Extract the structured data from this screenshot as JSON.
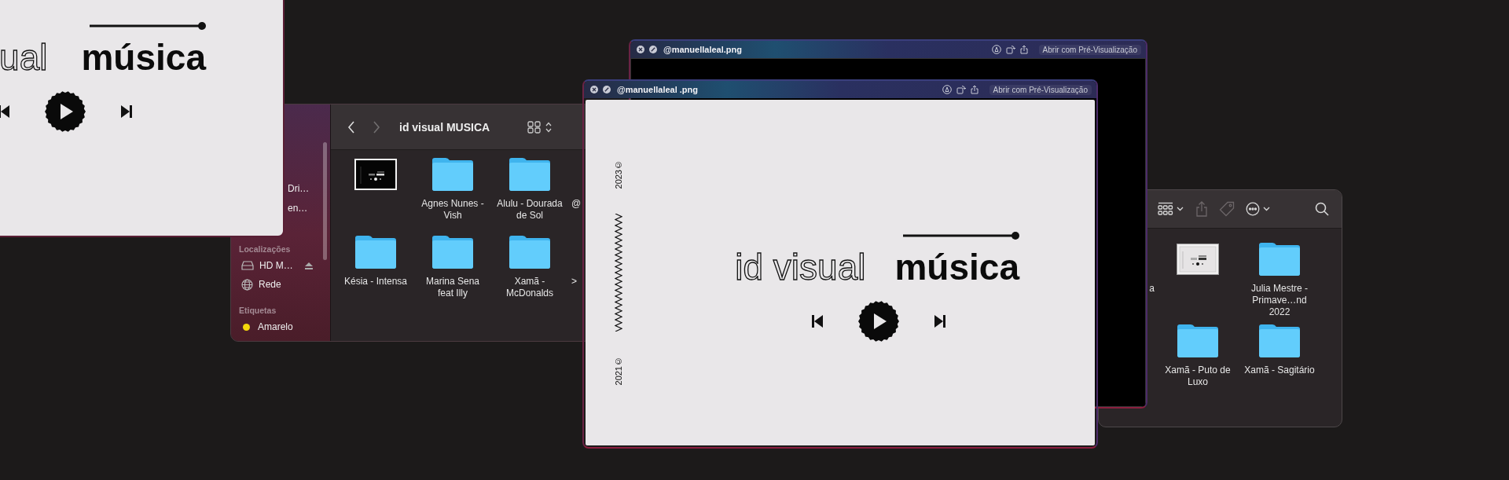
{
  "design_window": {
    "words": [
      {
        "text": "ual",
        "kind": "outline"
      },
      {
        "text": "música",
        "kind": "solid"
      }
    ]
  },
  "finder_left": {
    "sidebar": {
      "cut_items": [
        "Dri…",
        "en…"
      ],
      "sections": [
        {
          "heading": "Localizações",
          "items": [
            {
              "kind": "drive",
              "label": "HD M…",
              "eject": true
            },
            {
              "kind": "network",
              "label": "Rede"
            }
          ]
        },
        {
          "heading": "Etiquetas",
          "items": [
            {
              "kind": "tag",
              "label": "Amarelo",
              "color": "#f4d70b"
            }
          ]
        }
      ]
    },
    "title": "id visual MUSICA",
    "forward_disabled": true,
    "rows": [
      [
        {
          "kind": "image"
        },
        {
          "kind": "folder",
          "label": "Agnes Nunes - Vish"
        },
        {
          "kind": "folder",
          "label": "Alulu - Dourada de Sol"
        },
        {
          "kind": "cut",
          "label": "@"
        }
      ],
      [
        {
          "kind": "folder",
          "label": "Késia - Intensa"
        },
        {
          "kind": "folder",
          "label": "Marina Sena feat Illy"
        },
        {
          "kind": "folder",
          "label": "Xamã - McDonalds"
        },
        {
          "kind": "cut",
          "label": ">"
        }
      ]
    ]
  },
  "finder_right": {
    "toolbar": [
      {
        "kind": "view",
        "disabled": false
      },
      {
        "kind": "share",
        "disabled": true
      },
      {
        "kind": "tag",
        "disabled": true
      },
      {
        "kind": "more",
        "disabled": false
      },
      {
        "kind": "search",
        "disabled": false
      }
    ],
    "rows": [
      [
        {
          "kind": "cut",
          "label": "a"
        },
        {
          "kind": "image"
        },
        {
          "kind": "folder",
          "label": "Julia Mestre - Primave…nd 2022"
        }
      ],
      [
        {
          "kind": "folder",
          "label": "Xamã - Puto de Luxo"
        },
        {
          "kind": "folder",
          "label": "Xamã - Sagitário"
        }
      ]
    ]
  },
  "preview_windows": [
    {
      "kind": "dark",
      "title": "@manuellaleal.png",
      "action": "Abrir com Pré-Visualização"
    },
    {
      "kind": "design",
      "title": "@manuellaleal .png",
      "action": "Abrir com Pré-Visualização",
      "years": [
        "2023©",
        "2021©"
      ],
      "words": [
        {
          "text": "id visual",
          "kind": "outline"
        },
        {
          "text": "música",
          "kind": "solid"
        }
      ]
    }
  ]
}
